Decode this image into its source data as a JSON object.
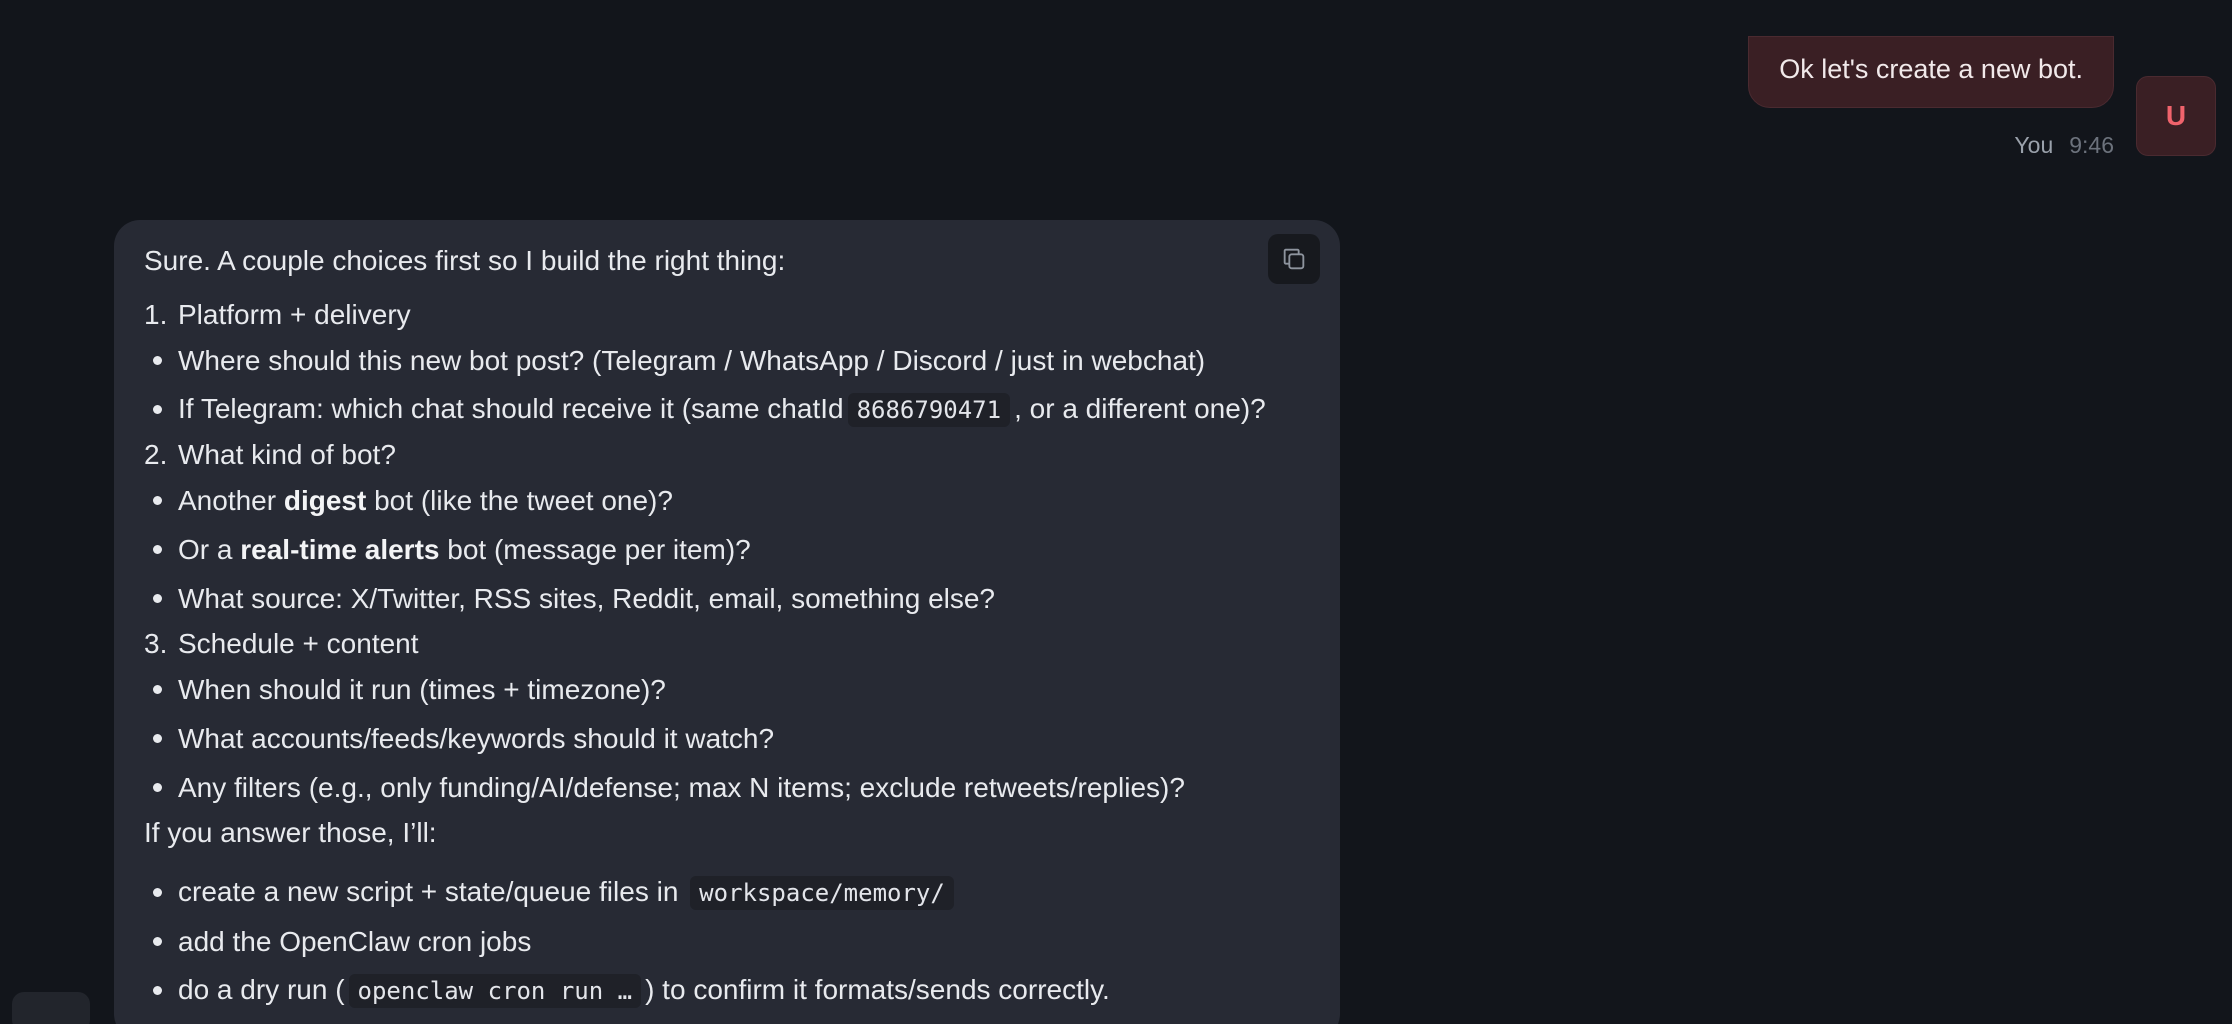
{
  "user_message": {
    "text": "Ok let's create a new bot.",
    "sender": "You",
    "time": "9:46",
    "avatar_initial": "U"
  },
  "assistant_message": {
    "intro": "Sure. A couple choices first so I build the right thing:",
    "copy_icon": "copy-icon",
    "n1": {
      "num": "1.",
      "text": "Platform + delivery"
    },
    "b1": "Where should this new bot post? (Telegram / WhatsApp / Discord / just in webchat)",
    "b2": {
      "pre": "If Telegram: which chat should receive it (same chatId",
      "code": "8686790471",
      "post": ", or a different one)?"
    },
    "n2": {
      "num": "2.",
      "text": "What kind of bot?"
    },
    "b3": {
      "pre": "Another",
      "bold": "digest",
      "post": "bot (like the tweet one)?"
    },
    "b4": {
      "pre": "Or a",
      "bold": "real-time alerts",
      "post": "bot (message per item)?"
    },
    "b5": "What source: X/Twitter, RSS sites, Reddit, email, something else?",
    "n3": {
      "num": "3.",
      "text": "Schedule + content"
    },
    "b6": "When should it run (times + timezone)?",
    "b7": "What accounts/feeds/keywords should it watch?",
    "b8": "Any filters (e.g., only funding/AI/defense; max N items; exclude retweets/replies)?",
    "outro": "If you answer those, I’ll:",
    "b9": {
      "pre": "create a new script + state/queue files in",
      "code": "workspace/memory/"
    },
    "b10": "add the OpenClaw cron jobs",
    "b11": {
      "pre": "do a dry run (",
      "code": "openclaw cron run …",
      "post": ") to confirm it formats/sends correctly."
    }
  },
  "colors": {
    "background": "#12151b",
    "assistant_bubble": "#272a34",
    "user_bubble": "#3a1f24",
    "avatar_text": "#f0636c"
  }
}
